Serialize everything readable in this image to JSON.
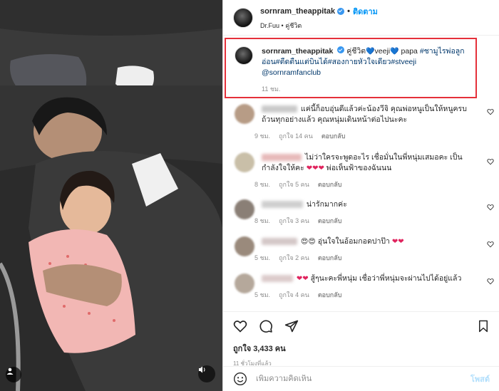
{
  "header": {
    "username": "sornram_theappitak",
    "separator": "•",
    "follow_label": "ติดตาม",
    "audio": "Dr.Fuu",
    "audio_sep": "•",
    "audio_title": "คู่ชีวิต"
  },
  "caption": {
    "username": "sornram_theappitak",
    "text_a": "คู่ชีวิต",
    "text_b": "veeji",
    "text_c": "papa",
    "hashtags": "#ชามูไรพ่อลูกอ่อน#ตืดตืนแต่บินได้#สองกายหัวใจเดียว#stveeji",
    "mention": "@sornramfanclub",
    "time": "11 ชม."
  },
  "comments": [
    {
      "text": "แค่นี้ก็อบอุ่นดีแล้วค่ะน้องวีจิ คุณพ่อหนูเป็นให้หนูครบถ้วนทุกอย่างแล้ว คุณหนุ่มเดินหน้าต่อไปนะคะ",
      "time": "9 ชม.",
      "likes": "ถูกใจ 14 คน",
      "reply": "ตอบกลับ",
      "avatar_color": "#b79c86",
      "name_color": "#c9c9c9",
      "name_width": 50
    },
    {
      "text_a": "ไม่ว่าใครจะพูดอะไร เชื่อมั่นในพี่หนุ่มเสมอคะ เป็นกำลังใจให้คะ",
      "hearts": "❤❤❤",
      "text_b": "พ่อเห็นฟ้าของฉันนน",
      "time": "8 ชม.",
      "likes": "ถูกใจ 5 คน",
      "reply": "ตอบกลับ",
      "avatar_color": "#c9bfa8",
      "name_color": "#e7b9b9",
      "name_width": 56
    },
    {
      "text": "น่ารักมากค่ะ",
      "time": "8 ชม.",
      "likes": "ถูกใจ 3 คน",
      "reply": "ตอบกลับ",
      "avatar_color": "#8a7f76",
      "name_color": "#cfcfcf",
      "name_width": 58
    },
    {
      "emojis": "😍😍",
      "text": "อุ่นใจในอ้อมกอดปาป๊า",
      "hearts": "❤❤",
      "time": "5 ชม.",
      "likes": "ถูกใจ 2 คน",
      "reply": "ตอบกลับ",
      "avatar_color": "#9a8a7c",
      "name_color": "#d4c7c7",
      "name_width": 50
    },
    {
      "hearts": "❤❤",
      "text": "สู้ๆนะคะพี่หนุ่ม เชื่อว่าพี่หนุ่มจะผ่านไปได้อยู่แล้ว",
      "time": "5 ชม.",
      "likes": "ถูกใจ 4 คน",
      "reply": "ตอบกลับ",
      "avatar_color": "#b5a89b",
      "name_color": "#dccbcb",
      "name_width": 44
    }
  ],
  "actions": {
    "likes": "ถูกใจ 3,433 คน",
    "time_ago": "11 ชั่วโมงที่แล้ว"
  },
  "add_comment": {
    "placeholder": "เพิ่มความคิดเห็น",
    "post_label": "โพสต์"
  },
  "colors": {
    "highlight_border": "#e5303a",
    "link_blue": "#0095f6",
    "hashtag": "#00376b"
  }
}
